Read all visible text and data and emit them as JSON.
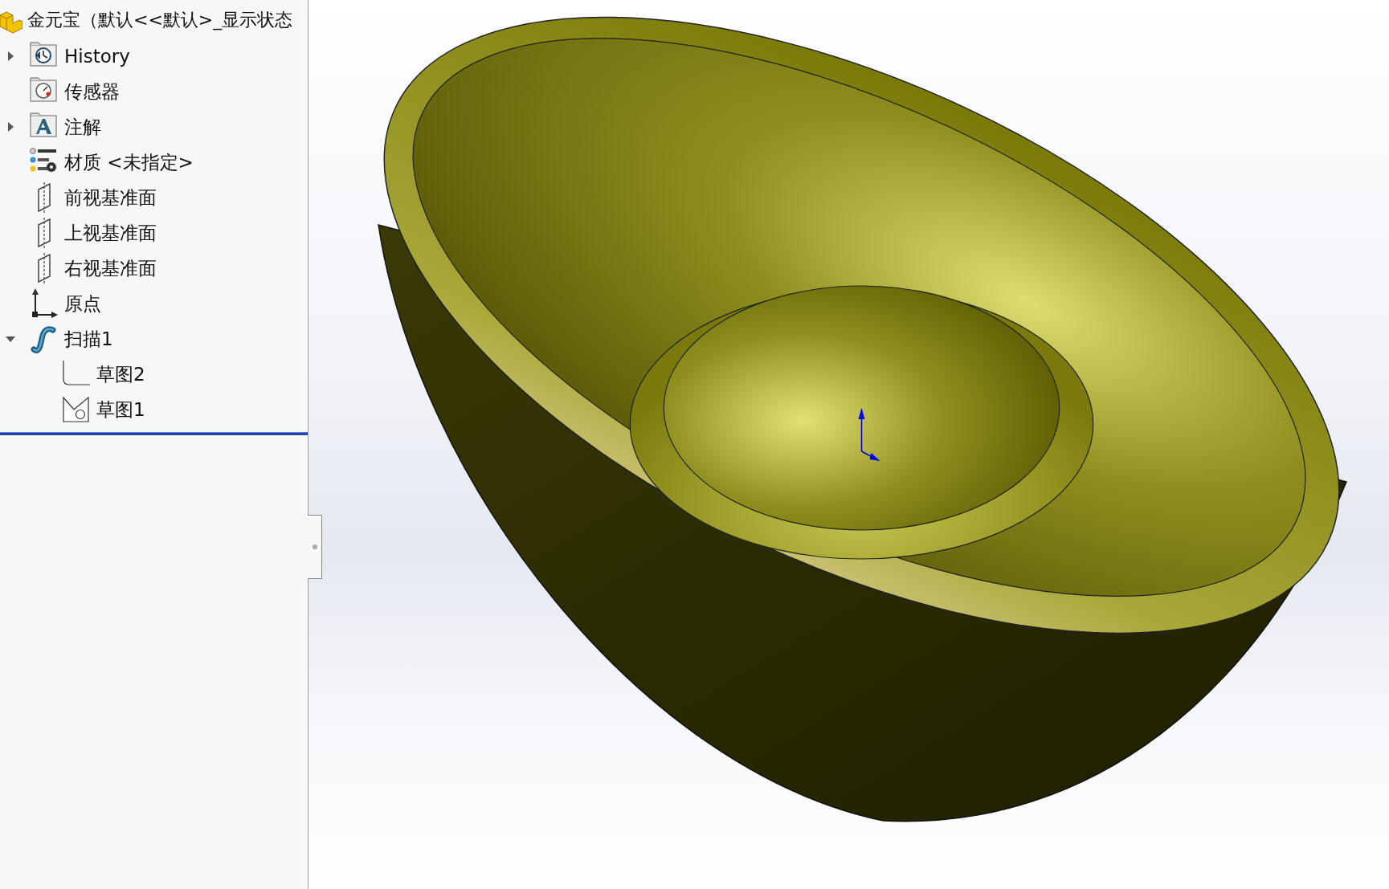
{
  "feature_tree": {
    "title": "金元宝（默认<<默认>_显示状态",
    "children": [
      {
        "label": "History",
        "kind": "history",
        "expanded": false
      },
      {
        "label": "传感器",
        "kind": "sensor"
      },
      {
        "label": "注解",
        "kind": "annotation",
        "expanded": false
      },
      {
        "label": "材质 <未指定>",
        "kind": "material"
      },
      {
        "label": "前视基准面",
        "kind": "plane"
      },
      {
        "label": "上视基准面",
        "kind": "plane"
      },
      {
        "label": "右视基准面",
        "kind": "plane"
      },
      {
        "label": "原点",
        "kind": "origin"
      },
      {
        "label": "扫描1",
        "kind": "sweep",
        "expanded": true,
        "children": [
          {
            "label": "草图2",
            "kind": "sketch-path"
          },
          {
            "label": "草图1",
            "kind": "sketch-profile"
          }
        ]
      }
    ]
  }
}
